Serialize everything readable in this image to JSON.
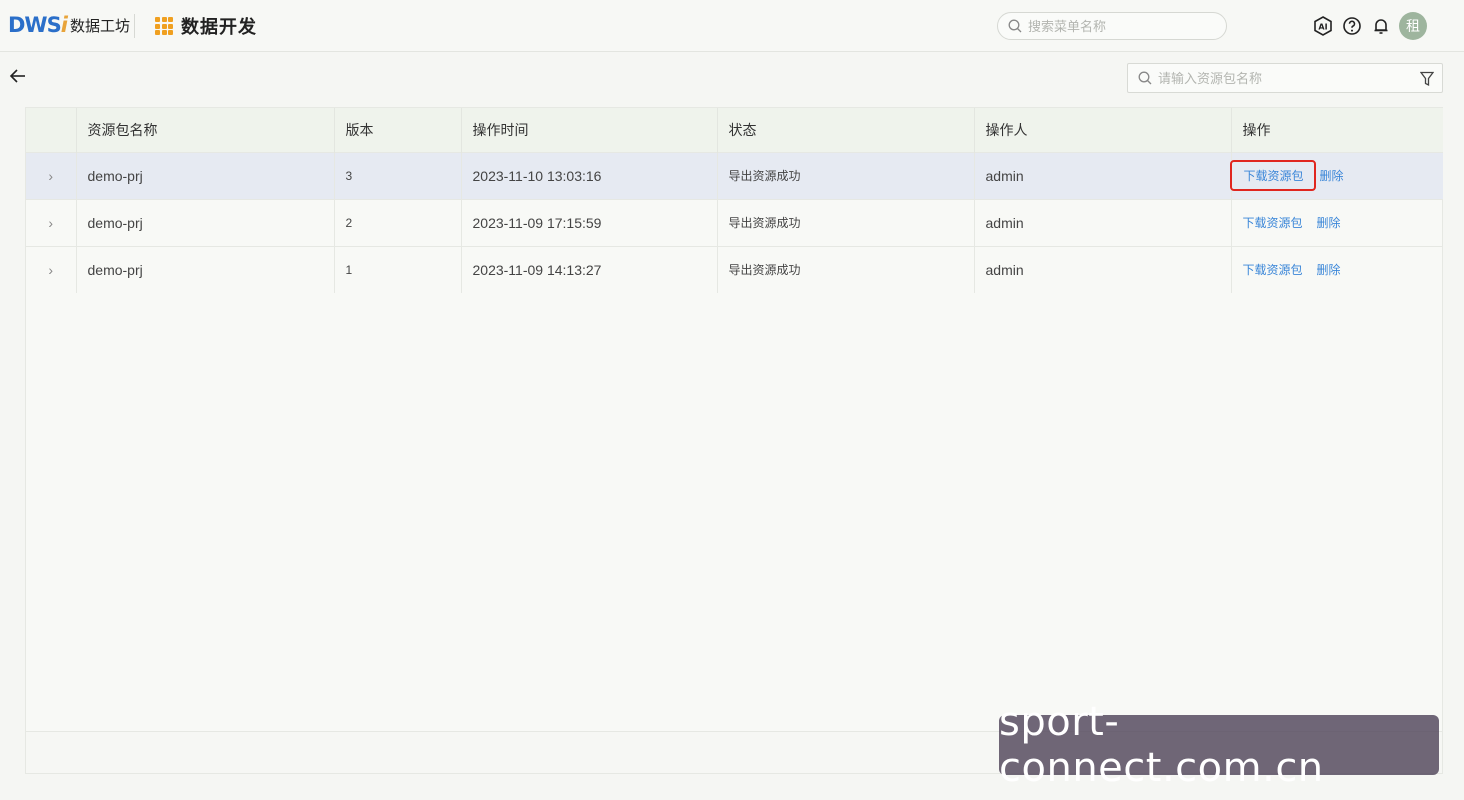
{
  "header": {
    "logo_mark": "DWS",
    "logo_mark_accent": "i",
    "logo_text": "数据工坊",
    "module_title": "数据开发",
    "menu_search_placeholder": "搜索菜单名称",
    "avatar_text": "租"
  },
  "toolbar": {
    "package_search_placeholder": "请输入资源包名称"
  },
  "table": {
    "columns": [
      "资源包名称",
      "版本",
      "操作时间",
      "状态",
      "操作人",
      "操作"
    ],
    "rows": [
      {
        "name": "demo-prj",
        "version": "3",
        "time": "2023-11-10 13:03:16",
        "status": "导出资源成功",
        "operator": "admin",
        "download": "下载资源包",
        "delete": "删除"
      },
      {
        "name": "demo-prj",
        "version": "2",
        "time": "2023-11-09 17:15:59",
        "status": "导出资源成功",
        "operator": "admin",
        "download": "下载资源包",
        "delete": "删除"
      },
      {
        "name": "demo-prj",
        "version": "1",
        "time": "2023-11-09 14:13:27",
        "status": "导出资源成功",
        "operator": "admin",
        "download": "下载资源包",
        "delete": "删除"
      }
    ]
  },
  "watermark": "sport-connect.com.cn",
  "colors": {
    "link": "#3a86d8",
    "highlight_border": "#e0261f",
    "selected_row": "#e6eaf2",
    "module_icon": "#f0a020"
  }
}
